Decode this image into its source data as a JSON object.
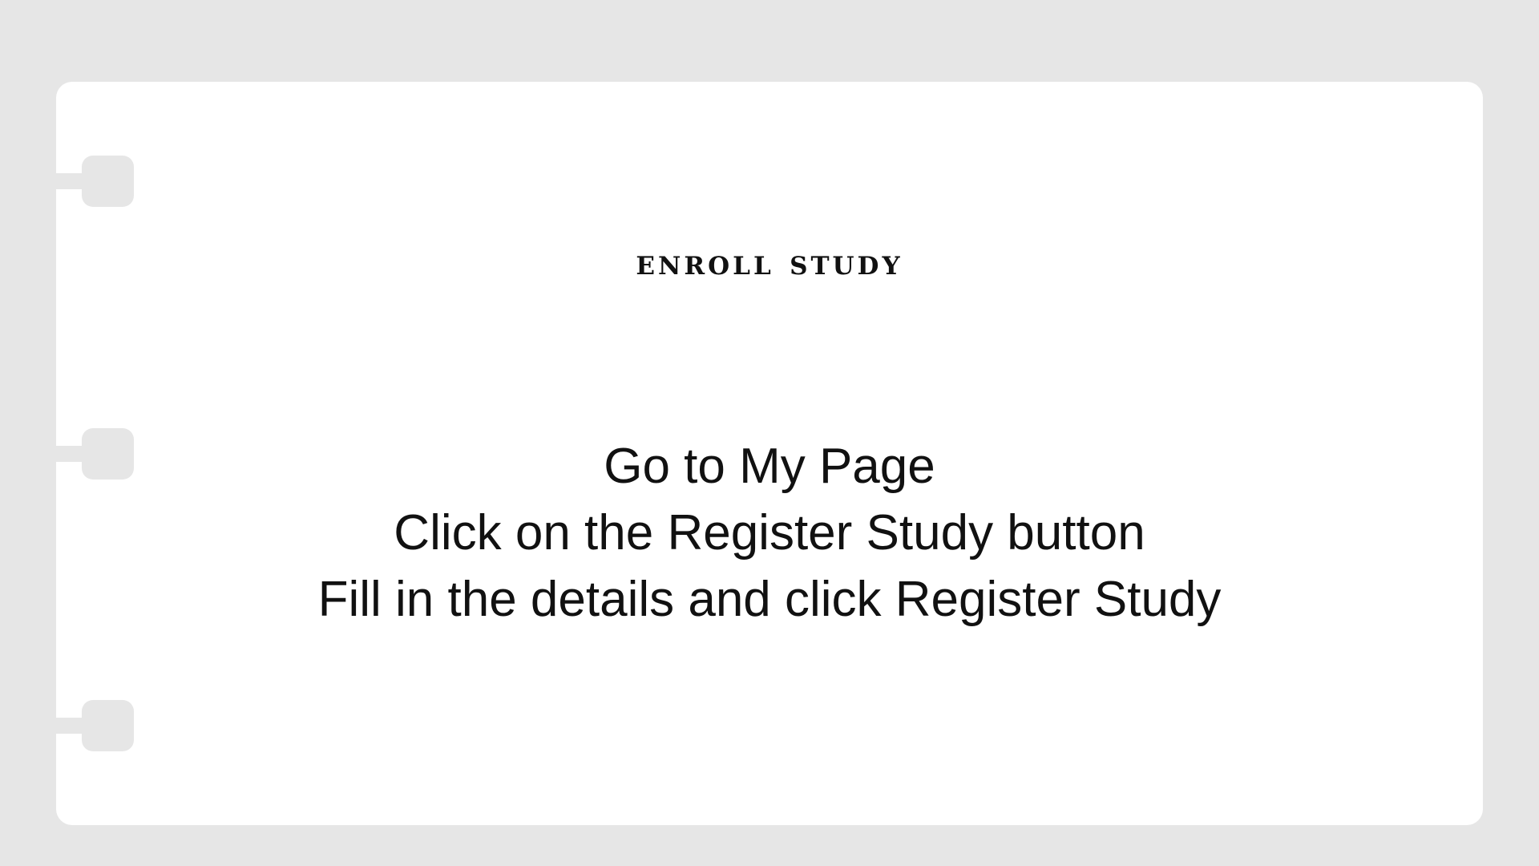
{
  "slide": {
    "title": "ENROLL STUDY",
    "steps": [
      "Go to My Page",
      "Click on the Register Study button",
      "Fill in the details and click Register Study"
    ]
  },
  "colors": {
    "background": "#e6e6e6",
    "card": "#ffffff",
    "text": "#111111"
  }
}
